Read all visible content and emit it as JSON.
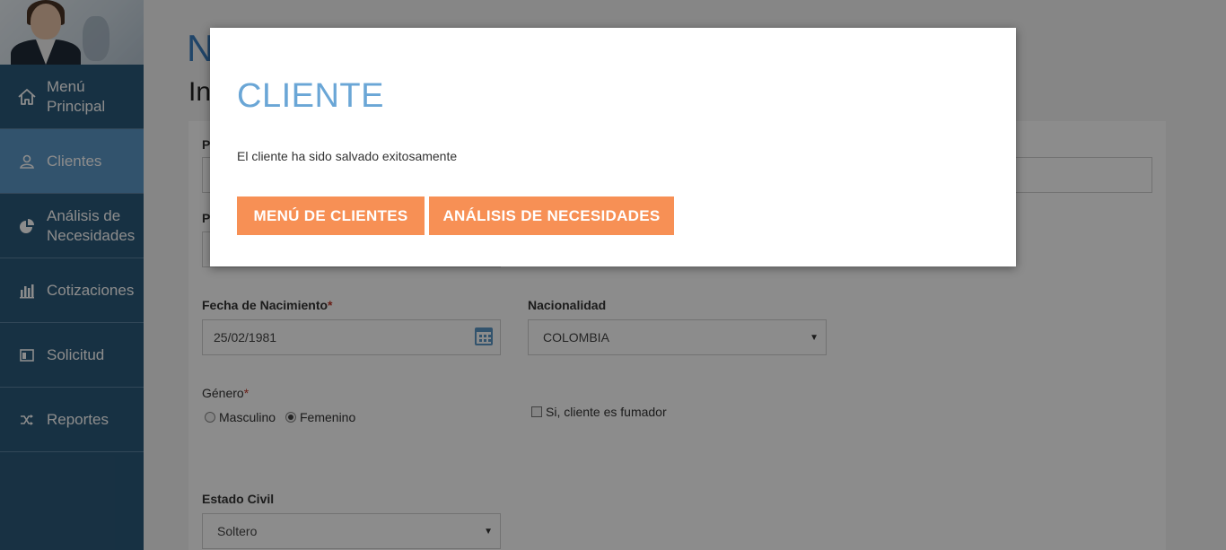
{
  "sidebar": {
    "items": [
      {
        "label": "Menú Principal",
        "icon": "home-icon"
      },
      {
        "label": "Clientes",
        "icon": "user-icon",
        "active": true
      },
      {
        "label": "Análisis de Necesidades",
        "icon": "pie-chart-icon"
      },
      {
        "label": "Cotizaciones",
        "icon": "bar-chart-icon"
      },
      {
        "label": "Solicitud",
        "icon": "form-icon"
      },
      {
        "label": "Reportes",
        "icon": "shuffle-icon"
      }
    ]
  },
  "background": {
    "page_title_fragment": "N",
    "page_subtitle_fragment": "In",
    "field_label_fragment_1": "P",
    "field_label_fragment_2": "P",
    "birth_date": {
      "label": "Fecha de Nacimiento",
      "required": "*",
      "value": "25/02/1981"
    },
    "nationality": {
      "label": "Nacionalidad",
      "value": "COLOMBIA"
    },
    "gender": {
      "label": "Género",
      "required": "*",
      "options": [
        "Masculino",
        "Femenino"
      ],
      "selected": "Femenino"
    },
    "smoker": {
      "label": "Si, cliente es fumador",
      "checked": false
    },
    "civil_status": {
      "label": "Estado Civil",
      "value": "Soltero"
    }
  },
  "modal": {
    "title": "CLIENTE",
    "message": "El cliente ha sido salvado exitosamente",
    "buttons": {
      "clients_menu": "MENÚ DE CLIENTES",
      "needs_analysis": "ANÁLISIS DE NECESIDADES"
    }
  },
  "colors": {
    "sidebar_bg": "#2b5a7a",
    "sidebar_active": "#5c98c6",
    "button_orange": "#f79055",
    "modal_title": "#6aa6d6"
  }
}
